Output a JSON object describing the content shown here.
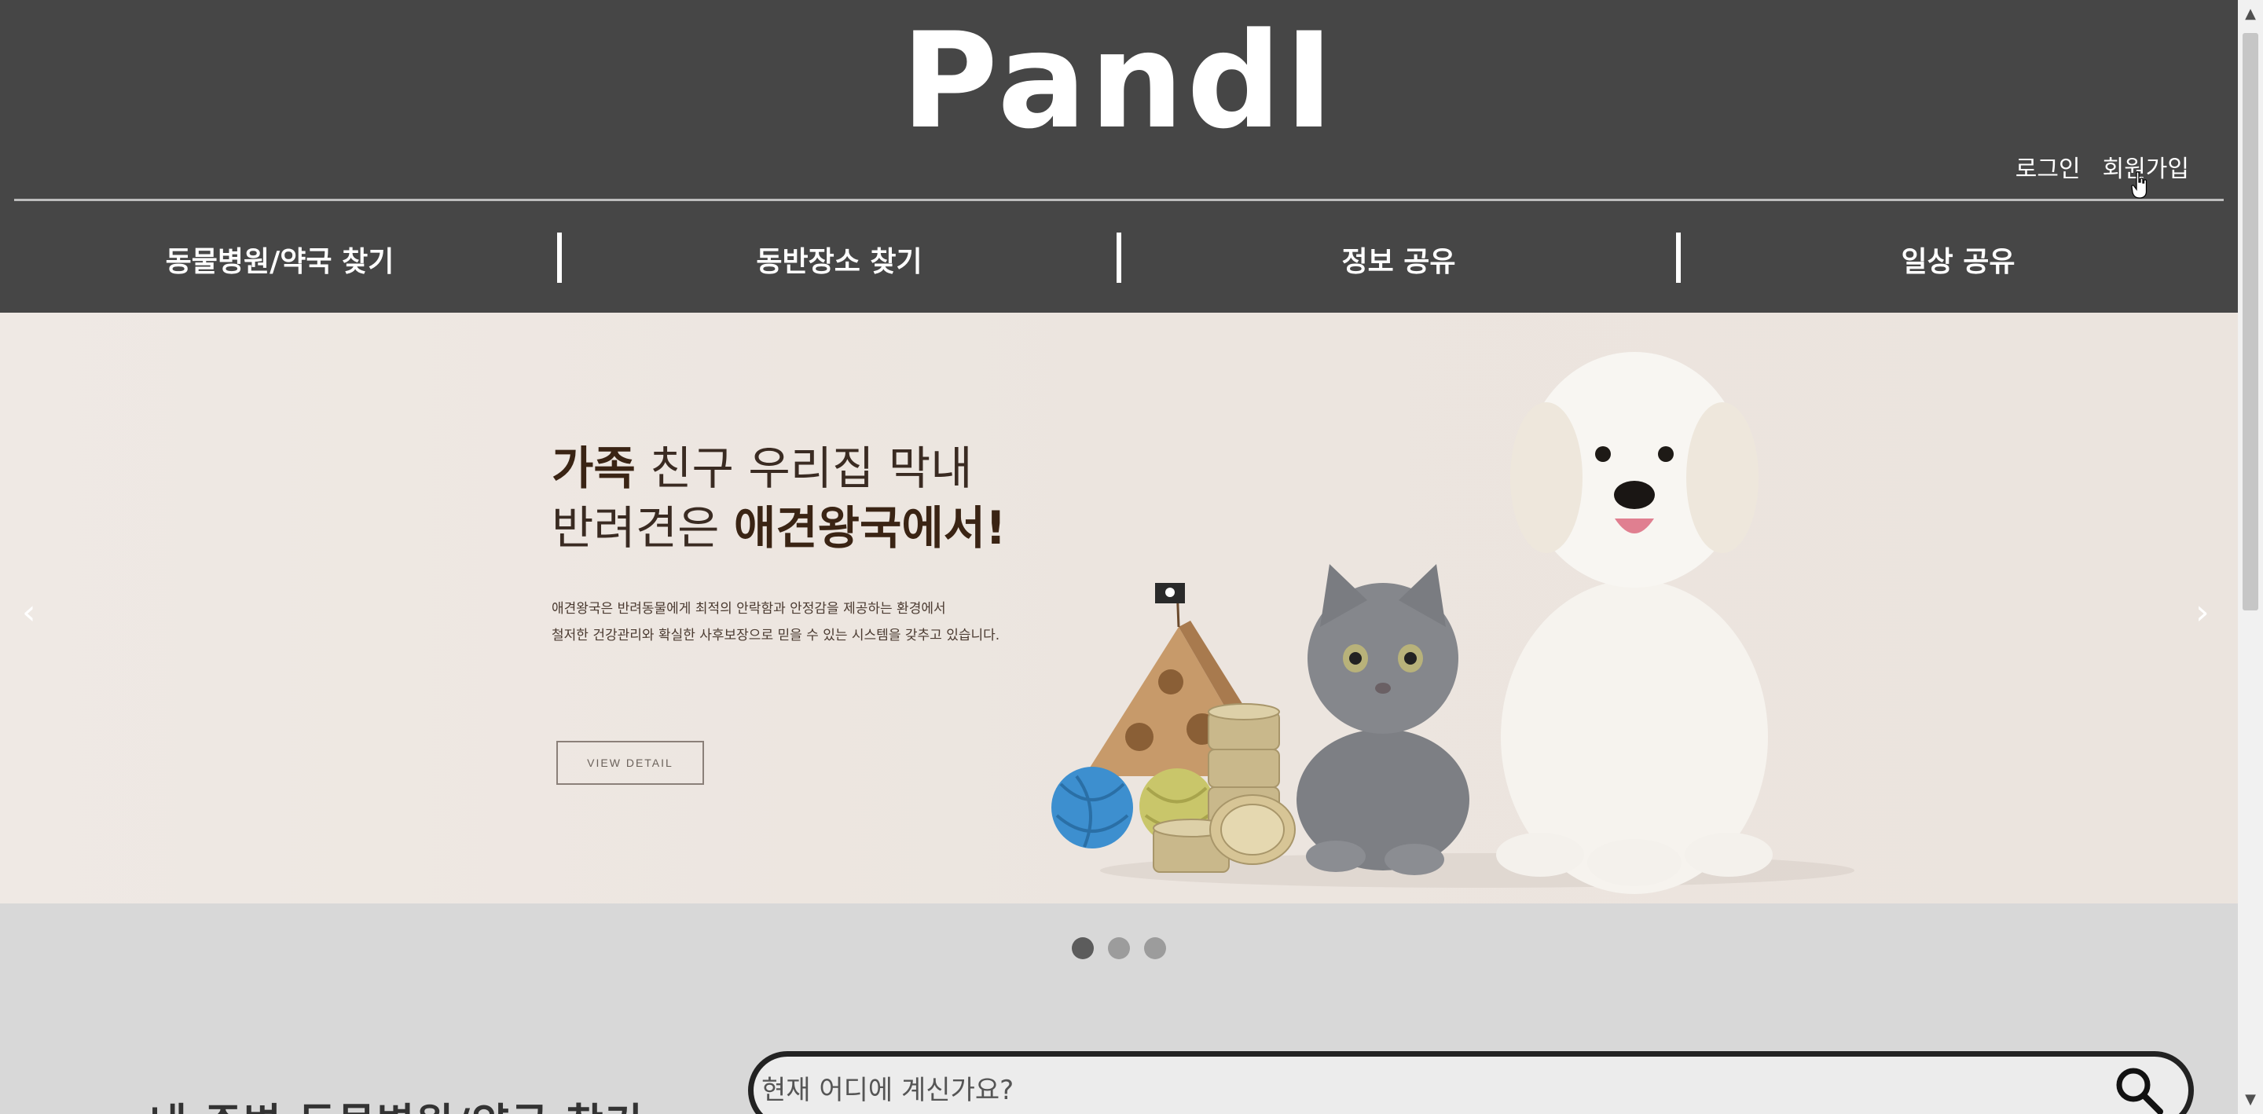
{
  "header": {
    "logo_text": "PandI",
    "auth": {
      "login": "로그인",
      "signup": "회원가입"
    }
  },
  "nav": {
    "items": [
      {
        "label": "동물병원/약국 찾기"
      },
      {
        "label": "동반장소 찾기"
      },
      {
        "label": "정보 공유"
      },
      {
        "label": "일상 공유"
      }
    ]
  },
  "hero": {
    "title_line1_bold": "가족",
    "title_line1_rest": " 친구 우리집 막내",
    "title_line2_rest": "반려견은 ",
    "title_line2_bold": "애견왕국에서!",
    "desc_line1": "애견왕국은 반려동물에게 최적의 안락함과 안정감을 제공하는 환경에서",
    "desc_line2": "철저한 건강관리와 확실한 사후보장으로 믿을 수 있는 시스템을 갖추고 있습니다.",
    "button_label": "VIEW DETAIL",
    "prev_arrow": "‹",
    "next_arrow": "›"
  },
  "carousel": {
    "slides": 3,
    "active_index": 0
  },
  "search": {
    "heading": "내 주변 동물병원/약국 찾기",
    "placeholder": "현재 어디에 계신가요?"
  },
  "icons": {
    "search": "search-icon",
    "prev": "chevron-left-icon",
    "next": "chevron-right-icon",
    "cursor": "hand-cursor-icon"
  },
  "colors": {
    "header_bg": "#464646",
    "hero_bg": "#ece5df",
    "page_bg": "#d8d8d8",
    "title_brown": "#3a2414"
  }
}
